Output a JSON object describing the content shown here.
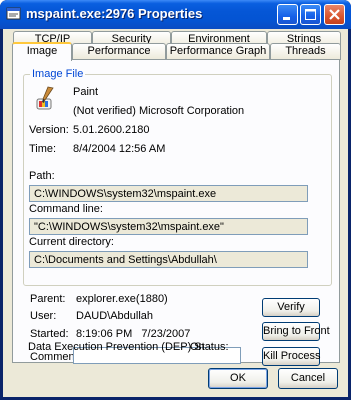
{
  "window": {
    "title": "mspaint.exe:2976 Properties",
    "icon": "process-properties-icon",
    "buttons": {
      "minimize": "_",
      "maximize": "□",
      "close": "✕"
    }
  },
  "tabs_row1": [
    "TCP/IP",
    "Security",
    "Environment",
    "Strings"
  ],
  "tabs_row2": [
    "Image",
    "Performance",
    "Performance Graph",
    "Threads"
  ],
  "active_tab": "Image",
  "image_file": {
    "group_label": "Image File",
    "icon": "paint-brush-icon",
    "product": "Paint",
    "company": "(Not verified) Microsoft Corporation",
    "version_label": "Version:",
    "version": "5.01.2600.2180",
    "time_label": "Time:",
    "time": "8/4/2004 12:56 AM",
    "path_label": "Path:",
    "path": "C:\\WINDOWS\\system32\\mspaint.exe",
    "cmdline_label": "Command line:",
    "cmdline": "\"C:\\WINDOWS\\system32\\mspaint.exe\"",
    "curdir_label": "Current directory:",
    "curdir": "C:\\Documents and Settings\\Abdullah\\"
  },
  "process": {
    "parent_label": "Parent:",
    "parent": "explorer.exe(1880)",
    "user_label": "User:",
    "user": "DAUD\\Abdullah",
    "started_label": "Started:",
    "started": "8:19:06 PM   7/23/2007",
    "comment_label": "Comment:",
    "comment_value": "",
    "dep_label": "Data Execution Prevention (DEP) Status:",
    "dep_value": "On"
  },
  "buttons": {
    "verify": "Verify",
    "bring_to_front": "Bring to Front",
    "kill_process": "Kill Process",
    "ok": "OK",
    "cancel": "Cancel"
  }
}
